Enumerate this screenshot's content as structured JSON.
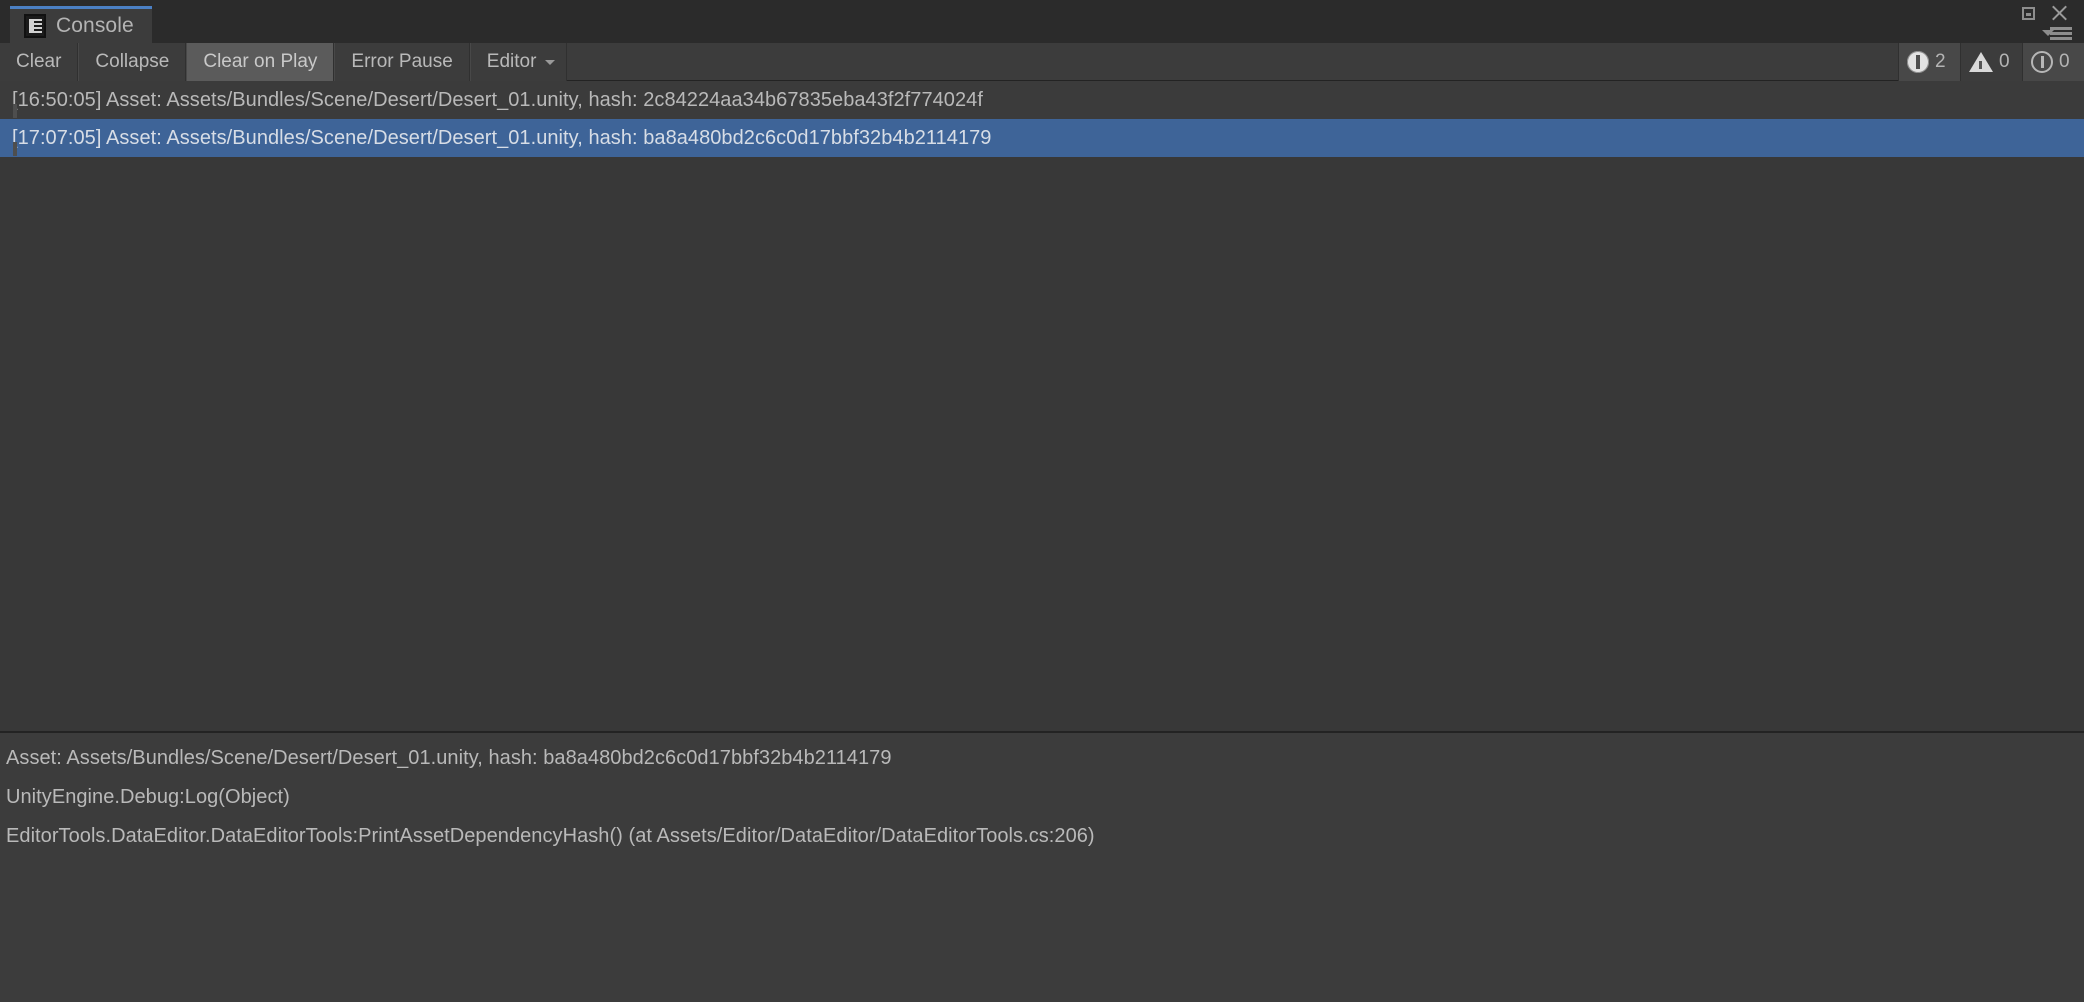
{
  "window": {
    "title": "Console",
    "tab_icon": "console-icon",
    "controls": {
      "maximize_icon": "maximize-icon",
      "close_icon": "close-icon",
      "menu_icon": "hamburger-menu-icon"
    }
  },
  "toolbar": {
    "clear_label": "Clear",
    "collapse_label": "Collapse",
    "clear_on_play_label": "Clear on Play",
    "error_pause_label": "Error Pause",
    "editor_label": "Editor",
    "editor_caret_icon": "chevron-down-icon",
    "active_button": "Clear on Play",
    "counters": {
      "errors": {
        "icon": "error-icon",
        "count": "2"
      },
      "warnings": {
        "icon": "warning-icon",
        "count": "0"
      },
      "infos": {
        "icon": "info-icon",
        "count": "0"
      }
    }
  },
  "log_entries": [
    {
      "icon": "error-icon",
      "text": "[16:50:05] Asset: Assets/Bundles/Scene/Desert/Desert_01.unity, hash: 2c84224aa34b67835eba43f2f774024f",
      "timestamp": "16:50:05",
      "selected": false
    },
    {
      "icon": "error-icon",
      "text": "[17:07:05] Asset: Assets/Bundles/Scene/Desert/Desert_01.unity, hash: ba8a480bd2c6c0d17bbf32b4b2114179",
      "timestamp": "17:07:05",
      "selected": true
    }
  ],
  "detail": {
    "line1": "Asset: Assets/Bundles/Scene/Desert/Desert_01.unity, hash: ba8a480bd2c6c0d17bbf32b4b2114179",
    "line2": "UnityEngine.Debug:Log(Object)",
    "line3": "EditorTools.DataEditor.DataEditorTools:PrintAssetDependencyHash() (at Assets/Editor/DataEditor/DataEditorTools.cs:206)"
  },
  "colors": {
    "background": "#383838",
    "panel": "#3c3c3c",
    "tabbar": "#2b2b2b",
    "selection": "#3e6498",
    "tab_accent": "#4b80c4",
    "text": "#b9b9b9",
    "active_button": "#5b5b5b"
  }
}
